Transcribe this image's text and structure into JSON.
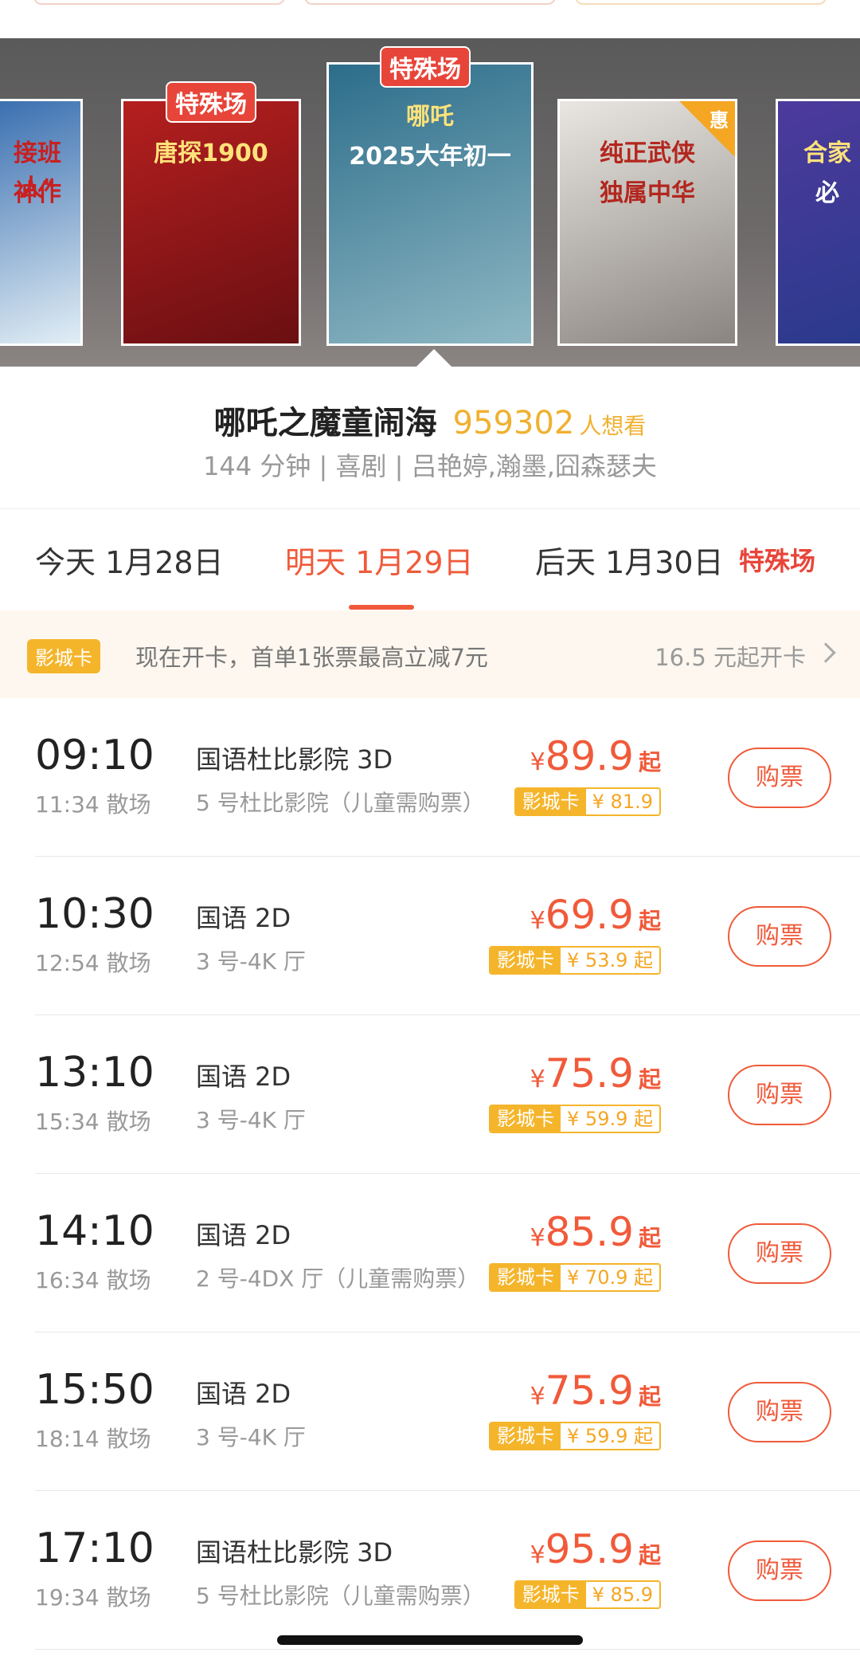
{
  "carousel": {
    "posters": [
      {
        "tag": "",
        "line1": "接班人\"",
        "line2": "神作",
        "colors": [
          "#3a6fb0",
          "#e2eef5"
        ]
      },
      {
        "tag": "特殊场",
        "line1": "唐探1900",
        "line2": "",
        "colors": [
          "#b51f1f",
          "#6a0f12"
        ]
      },
      {
        "tag": "特殊场",
        "line1": "哪吒",
        "line2": "2025大年初一",
        "colors": [
          "#2c6d8a",
          "#8fb8c4"
        ]
      },
      {
        "tag": "",
        "line1": "纯正武侠",
        "line2": "独属中华",
        "badge": "惠",
        "colors": [
          "#e9e6e1",
          "#8a8580"
        ]
      },
      {
        "tag": "",
        "line1": "合家",
        "line2": "必",
        "colors": [
          "#4d3a9c",
          "#2a3a8c"
        ]
      }
    ]
  },
  "movie": {
    "title": "哪吒之魔童闹海",
    "want_count": "959302",
    "want_label": "人想看",
    "meta": "144 分钟 | 喜剧 | 吕艳婷,瀚墨,囧森瑟夫"
  },
  "date_tabs": [
    {
      "label": "今天 1月28日",
      "active": false
    },
    {
      "label": "明天 1月29日",
      "active": true
    },
    {
      "label": "后天 1月30日",
      "active": false
    }
  ],
  "special_label": "特殊场",
  "card_banner": {
    "badge": "影城卡",
    "text": "现在开卡，首单1张票最高立减7元",
    "right": "16.5 元起开卡"
  },
  "sessions": [
    {
      "start": "09:10",
      "end": "11:34 散场",
      "lang": "国语杜比影院 3D",
      "hall": "5 号杜比影院（儿童需购票）",
      "yen": "¥",
      "price": "89.9",
      "qi": "起",
      "card_label": "影城卡",
      "card_price": "¥ 81.9",
      "buy": "购票"
    },
    {
      "start": "10:30",
      "end": "12:54 散场",
      "lang": "国语 2D",
      "hall": "3 号-4K 厅",
      "yen": "¥",
      "price": "69.9",
      "qi": "起",
      "card_label": "影城卡",
      "card_price": "¥ 53.9 起",
      "buy": "购票"
    },
    {
      "start": "13:10",
      "end": "15:34 散场",
      "lang": "国语 2D",
      "hall": "3 号-4K 厅",
      "yen": "¥",
      "price": "75.9",
      "qi": "起",
      "card_label": "影城卡",
      "card_price": "¥ 59.9 起",
      "buy": "购票"
    },
    {
      "start": "14:10",
      "end": "16:34 散场",
      "lang": "国语 2D",
      "hall": "2 号-4DX 厅（儿童需购票）",
      "yen": "¥",
      "price": "85.9",
      "qi": "起",
      "card_label": "影城卡",
      "card_price": "¥ 70.9 起",
      "buy": "购票"
    },
    {
      "start": "15:50",
      "end": "18:14 散场",
      "lang": "国语 2D",
      "hall": "3 号-4K 厅",
      "yen": "¥",
      "price": "75.9",
      "qi": "起",
      "card_label": "影城卡",
      "card_price": "¥ 59.9 起",
      "buy": "购票"
    },
    {
      "start": "17:10",
      "end": "19:34 散场",
      "lang": "国语杜比影院 3D",
      "hall": "5 号杜比影院（儿童需购票）",
      "yen": "¥",
      "price": "95.9",
      "qi": "起",
      "card_label": "影城卡",
      "card_price": "¥ 85.9",
      "buy": "购票"
    }
  ]
}
